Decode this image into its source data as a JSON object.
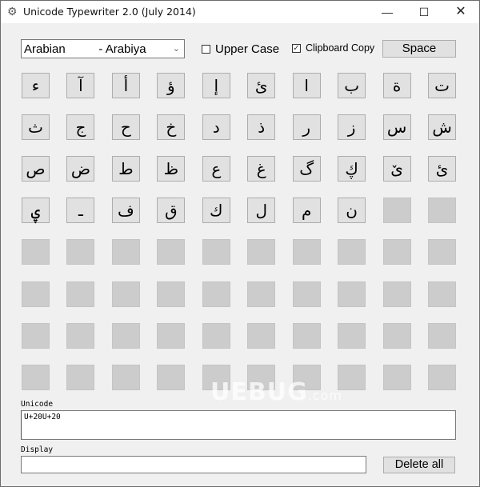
{
  "window": {
    "title": "Unicode Typewriter 2.0 (July 2014)",
    "app_icon": "⚙",
    "controls": {
      "minimize": "—",
      "maximize": "☐",
      "close": "✕"
    }
  },
  "toolbar": {
    "language_select": {
      "value": "Arabian          - Arabiya",
      "arrow": "⌄"
    },
    "upper_case": {
      "label": "Upper Case",
      "checked": false,
      "mark": ""
    },
    "clipboard_copy": {
      "label": "Clipboard Copy",
      "checked": true,
      "mark": "✓"
    },
    "space_label": "Space"
  },
  "keys": [
    "ء",
    "آ",
    "أ",
    "ؤ",
    "إ",
    "ئ",
    "ا",
    "ب",
    "ة",
    "ت",
    "ث",
    "ج",
    "ح",
    "خ",
    "د",
    "ذ",
    "ر",
    "ز",
    "س",
    "ش",
    "ص",
    "ض",
    "ط",
    "ظ",
    "ع",
    "غ",
    "گ",
    "ڮ",
    "ێ",
    "ىٔ",
    "ۑ",
    "ـ",
    "ف",
    "ق",
    "ك",
    "ل",
    "م",
    "ن",
    "",
    "",
    "",
    "",
    "",
    "",
    "",
    "",
    "",
    "",
    "",
    "",
    "",
    "",
    "",
    "",
    "",
    "",
    "",
    "",
    "",
    "",
    "",
    "",
    "",
    "",
    "",
    "",
    "",
    "",
    "",
    "",
    "",
    "",
    "",
    "",
    "",
    "",
    "",
    "",
    "",
    ""
  ],
  "unicode": {
    "label": "Unicode",
    "value": "U+20U+20"
  },
  "display": {
    "label": "Display",
    "value": ""
  },
  "delete_all_label": "Delete all",
  "watermark": {
    "main": "UEBUG",
    "suffix": ".com"
  }
}
